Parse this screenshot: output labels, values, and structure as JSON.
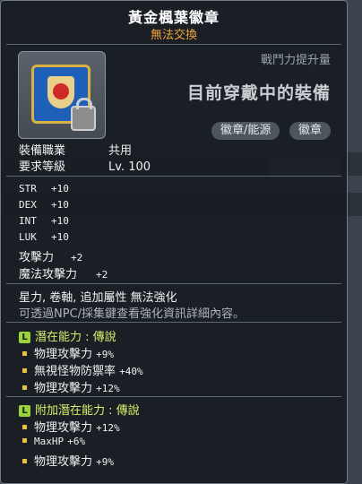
{
  "item": {
    "name": "黃金楓葉徽章",
    "trade_status": "無法交換",
    "icon": "gold-maple-leaf-badge-icon",
    "locked_icon": "lock-icon"
  },
  "compare": {
    "power_up_label": "戰鬥力提升量",
    "equipped_text": "目前穿戴中的裝備",
    "tag1": "徽章/能源",
    "tag2": "徽章"
  },
  "requirements": {
    "job_label": "裝備職業",
    "job_value": "共用",
    "level_label": "要求等級",
    "level_value": "Lv. 100"
  },
  "stats": [
    {
      "label": "STR",
      "value": "+10"
    },
    {
      "label": "DEX",
      "value": "+10"
    },
    {
      "label": "INT",
      "value": "+10"
    },
    {
      "label": "LUK",
      "value": "+10"
    },
    {
      "label": "攻擊力",
      "value": "+2"
    },
    {
      "label": "魔法攻擊力",
      "value": "+2"
    }
  ],
  "notes": {
    "line1": "星力, 卷軸, 追加屬性 無法強化",
    "line2": "可透過NPC/採集鍵查看強化資訊詳細內容。"
  },
  "potential": {
    "badge": "L",
    "title": "潛在能力 : 傳說",
    "lines": [
      {
        "label": "物理攻擊力",
        "value": "+9%"
      },
      {
        "label": "無視怪物防禦率",
        "value": "+40%"
      },
      {
        "label": "物理攻擊力",
        "value": "+12%"
      }
    ]
  },
  "bonus_potential": {
    "badge": "L",
    "title": "附加潛在能力 : 傳說",
    "lines": [
      {
        "label": "物理攻擊力",
        "value": "+12%"
      },
      {
        "label": "MaxHP",
        "value": "+6%"
      },
      {
        "label": "物理攻擊力",
        "value": "+9%"
      }
    ]
  },
  "colors": {
    "title": "#ffffff",
    "trade_status": "#f2a53a",
    "potential_title": "#d6f26a",
    "bullet": "#e8c33a"
  }
}
